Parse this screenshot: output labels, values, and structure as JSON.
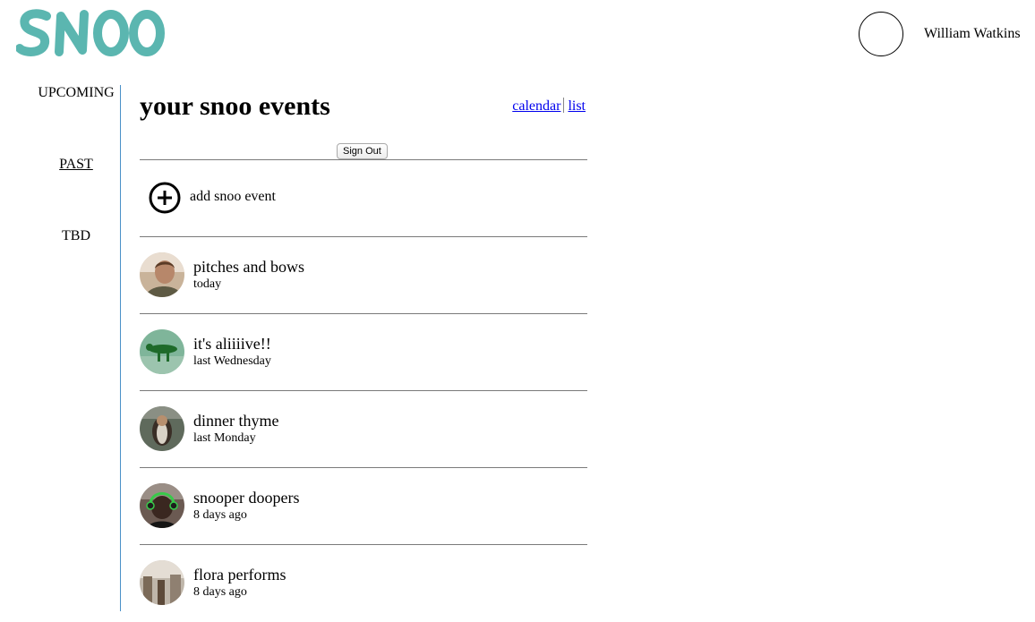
{
  "header": {
    "logo_text": "SNOO",
    "logo_color": "#5bb6b0",
    "user_name": "William Watkins"
  },
  "sidebar": {
    "items": [
      {
        "label": "UPCOMING",
        "active": false
      },
      {
        "label": "PAST",
        "active": true
      },
      {
        "label": "TBD",
        "active": false
      }
    ],
    "divider_color": "#4a90c8"
  },
  "main": {
    "title": "your snoo events",
    "view_links": {
      "calendar": "calendar",
      "list": "list"
    },
    "link_color": "#0000ee",
    "signout_label": "Sign Out",
    "add_event_label": "add snoo event",
    "events": [
      {
        "title": "pitches and bows",
        "when": "today",
        "thumb_icon": "person-photo"
      },
      {
        "title": "it's aliiiive!!",
        "when": "last Wednesday",
        "thumb_icon": "green-figure-photo"
      },
      {
        "title": "dinner thyme",
        "when": "last Monday",
        "thumb_icon": "dog-photo"
      },
      {
        "title": "snooper doopers",
        "when": "8 days ago",
        "thumb_icon": "headphones-person-photo"
      },
      {
        "title": "flora performs",
        "when": "8 days ago",
        "thumb_icon": "stage-photo"
      }
    ]
  }
}
